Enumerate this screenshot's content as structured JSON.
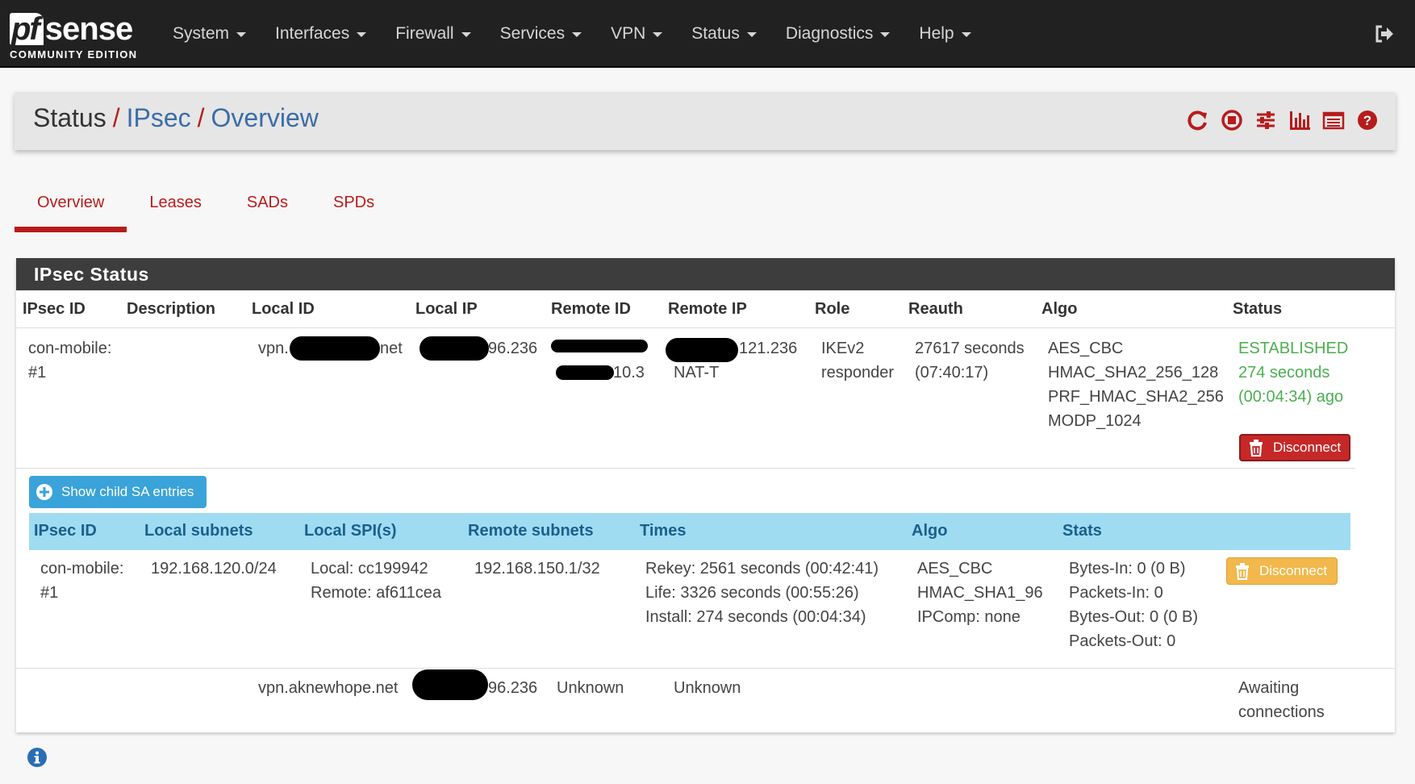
{
  "brand": {
    "logo_pf": "pf",
    "logo_sense": "sense",
    "logo_sub": "COMMUNITY EDITION"
  },
  "nav": {
    "items": [
      "System",
      "Interfaces",
      "Firewall",
      "Services",
      "VPN",
      "Status",
      "Diagnostics",
      "Help"
    ],
    "logout_icon": "sign-out-icon"
  },
  "breadcrumb": {
    "part1": "Status",
    "part2": "IPsec",
    "part3": "Overview",
    "sep": "/"
  },
  "header_icons": [
    "restart-icon",
    "stop-icon",
    "sliders-icon",
    "bar-chart-icon",
    "log-list-icon",
    "help-icon"
  ],
  "tabs": [
    "Overview",
    "Leases",
    "SADs",
    "SPDs"
  ],
  "panel": {
    "title": "IPsec Status"
  },
  "table": {
    "headers": [
      "IPsec ID",
      "Description",
      "Local ID",
      "Local IP",
      "Remote ID",
      "Remote IP",
      "Role",
      "Reauth",
      "Algo",
      "Status"
    ],
    "row1": {
      "ipsec_id": [
        "con-mobile:",
        "#1"
      ],
      "local_id_prefix": "vpn.",
      "local_id_suffix": "net",
      "local_ip_suffix": "96.236",
      "remote_id_suffix": "10.3",
      "remote_ip_suffix": "121.236",
      "remote_ip_nat": "NAT-T",
      "role": [
        "IKEv2",
        "responder"
      ],
      "reauth": [
        "27617 seconds",
        "(07:40:17)"
      ],
      "algo": [
        "AES_CBC",
        "HMAC_SHA2_256_128",
        "PRF_HMAC_SHA2_256",
        "MODP_1024"
      ],
      "status": [
        "ESTABLISHED",
        "274 seconds",
        "(00:04:34) ago"
      ],
      "disconnect": "Disconnect"
    },
    "show_child_button": "Show child SA entries",
    "child_headers": [
      "IPsec ID",
      "Local subnets",
      "Local SPI(s)",
      "Remote subnets",
      "Times",
      "Algo",
      "Stats"
    ],
    "child_row": {
      "ipsec_id": [
        "con-mobile:",
        "#1"
      ],
      "local_subnets": "192.168.120.0/24",
      "local_spi": [
        "Local: cc199942",
        "Remote: af611cea"
      ],
      "remote_subnets": "192.168.150.1/32",
      "times": [
        "Rekey: 2561 seconds (00:42:41)",
        "Life: 3326 seconds (00:55:26)",
        "Install: 274 seconds (00:04:34)"
      ],
      "algo": [
        "AES_CBC",
        "HMAC_SHA1_96",
        "IPComp: none"
      ],
      "stats": [
        "Bytes-In: 0 (0 B)",
        "Packets-In: 0",
        "Bytes-Out: 0 (0 B)",
        "Packets-Out: 0"
      ],
      "disconnect": "Disconnect"
    },
    "row2": {
      "local_id": "vpn.aknewhope.net",
      "local_ip_suffix": "96.236",
      "remote_id": "Unknown",
      "remote_ip": "Unknown",
      "status": [
        "Awaiting",
        "connections"
      ]
    }
  },
  "colors": {
    "accent_red": "#b71c1c",
    "link_blue": "#3b6da8",
    "established_green": "#4caf50",
    "child_header_bg": "#9fdcf2"
  }
}
